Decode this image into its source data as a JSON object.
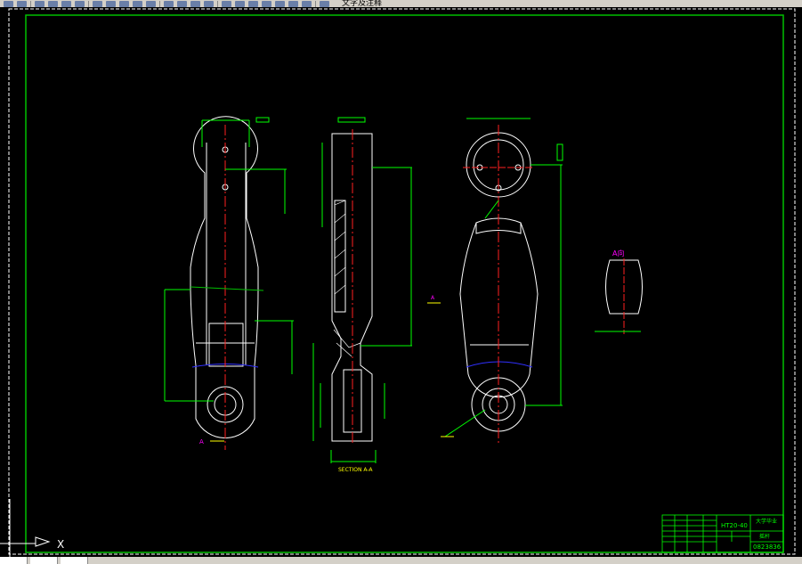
{
  "toolbar": {
    "layer_name": "文字及注释"
  },
  "drawing": {
    "section_label": "SECTION A-A",
    "view_label": "A向",
    "arrow_label": "A",
    "section_marker": "A"
  },
  "title_block": {
    "material": "HT20-40",
    "school": "大学毕业",
    "part_name": "摇杆",
    "drawing_number": "0823836"
  },
  "ucs": {
    "x_label": "X"
  },
  "colors": {
    "background": "#000000",
    "frame": "#00c000",
    "dimension": "#00ff00",
    "centerline": "#ff0000",
    "outline": "#ffffff",
    "note": "#ffff00"
  }
}
